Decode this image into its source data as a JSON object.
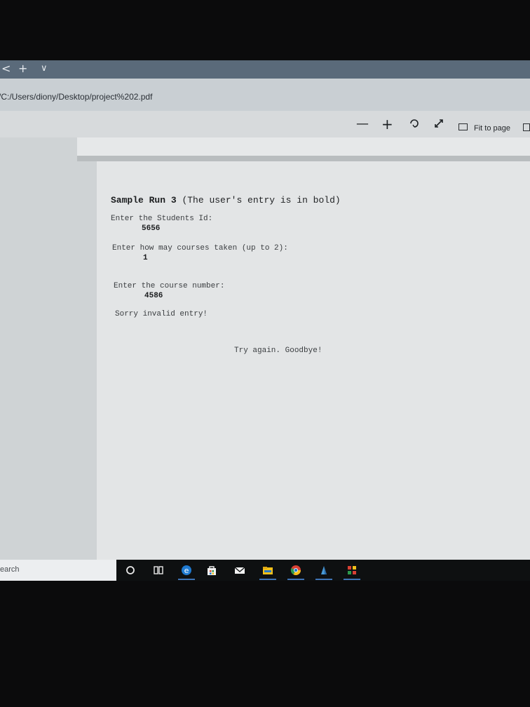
{
  "browser": {
    "tab_controls": [
      "<",
      "+",
      "∨"
    ],
    "url": "/C:/Users/diony/Desktop/project%202.pdf"
  },
  "pdf_toolbar": {
    "zoom_out_label": "—",
    "zoom_in_label": "+",
    "fit_label": "Fit to page"
  },
  "document": {
    "title_bold": "Sample Run 3",
    "title_rest": "(The user's entry is in bold)",
    "lines": [
      {
        "prompt": "Enter the Students Id:",
        "entry": "5656"
      },
      {
        "prompt": "Enter how may courses taken (up to 2):",
        "entry": "1"
      },
      {
        "prompt": "Enter the course number:",
        "entry": "4586"
      }
    ],
    "error": "Sorry invalid entry!",
    "closing": "Try again. Goodbye!"
  },
  "taskbar": {
    "search_text": "earch",
    "icons": [
      "cortana-circle-icon",
      "task-view-icon",
      "edge-icon",
      "store-icon",
      "mail-icon",
      "file-explorer-icon",
      "chrome-icon",
      "app-icon",
      "app-grid-icon"
    ]
  },
  "colors": {
    "accent": "#3f74b6",
    "edge_blue": "#1f7ad1",
    "chrome_red": "#d94134",
    "chrome_yellow": "#f3c01a",
    "chrome_green": "#2c9b4c"
  }
}
